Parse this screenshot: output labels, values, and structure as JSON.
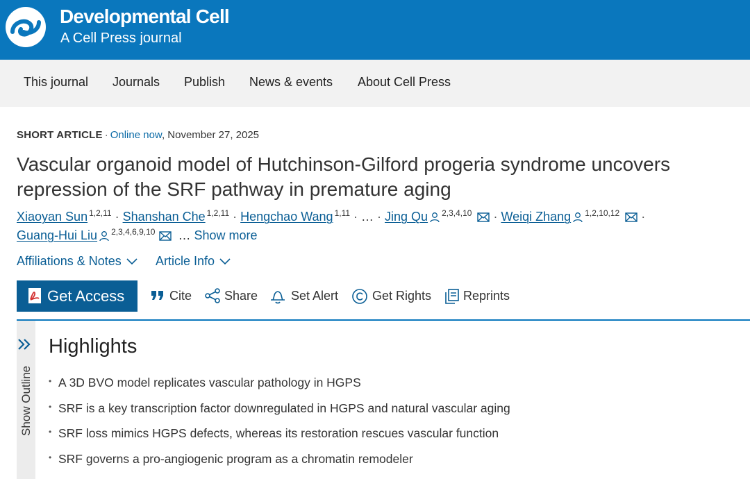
{
  "header": {
    "journal_name": "Developmental Cell",
    "journal_subtitle": "A Cell Press journal",
    "logo_icon": "cell-press-logo-icon"
  },
  "nav": {
    "items": [
      "This journal",
      "Journals",
      "Publish",
      "News & events",
      "About Cell Press"
    ]
  },
  "article": {
    "type": "SHORT ARTICLE",
    "separator": "·",
    "status": "Online now",
    "date": ", November 27, 2025",
    "title_line1": "Vascular organoid model of Hutchinson-Gilford progeria syndrome uncovers",
    "title_line2": "repression of the SRF pathway in premature aging"
  },
  "authors": {
    "a1": {
      "name": "Xiaoyan Sun",
      "sup": "1,2,11"
    },
    "a2": {
      "name": "Shanshan Che",
      "sup": "1,2,11"
    },
    "a3": {
      "name": "Hengchao Wang",
      "sup": "1,11"
    },
    "ellipsis": "…",
    "a4": {
      "name": "Jing Qu",
      "sup": "2,3,4,10"
    },
    "a5": {
      "name": "Weiqi Zhang",
      "sup": "1,2,10,12"
    },
    "a6": {
      "name": "Guang-Hui Liu",
      "sup": "2,3,4,6,9,10"
    },
    "trailing_ellipsis": "…",
    "show_more": "Show more",
    "person_icon": "person-icon",
    "email_icon": "envelope-icon"
  },
  "toggles": {
    "affiliations": "Affiliations & Notes",
    "article_info": "Article Info",
    "icon": "chevron-down-icon"
  },
  "actions": {
    "get_access": "Get Access",
    "cite": "Cite",
    "share": "Share",
    "set_alert": "Set Alert",
    "get_rights": "Get Rights",
    "reprints": "Reprints"
  },
  "outline": {
    "label": "Show Outline",
    "icon": "double-chevron-right-icon"
  },
  "highlights": {
    "title": "Highlights",
    "items": [
      "A 3D BVO model replicates vascular pathology in HGPS",
      "SRF is a key transcription factor downregulated in HGPS and natural vascular aging",
      "SRF loss mimics HGPS defects, whereas its restoration rescues vascular function",
      "SRF governs a pro-angiogenic program as a chromatin remodeler"
    ]
  },
  "colors": {
    "brand_blue": "#0a77bd",
    "link_blue": "#0a5e95",
    "nav_bg": "#f2f2f2"
  }
}
